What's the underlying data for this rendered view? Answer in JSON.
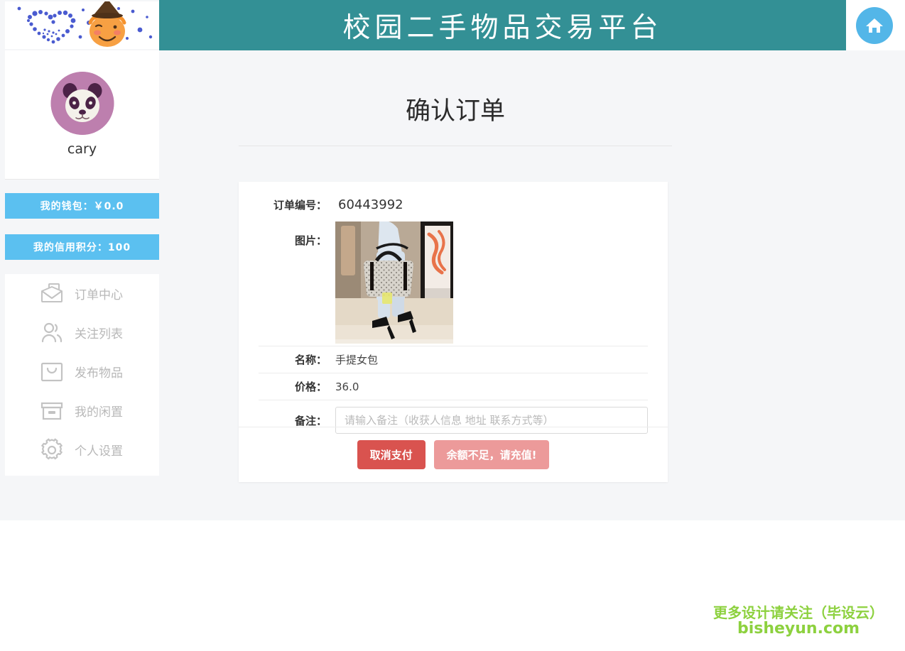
{
  "header": {
    "site_title": "校园二手物品交易平台",
    "home_icon": "home-icon",
    "bg_color": "#339095",
    "home_color": "#53b6e8"
  },
  "sidebar": {
    "banner_icons": [
      "dotted-heart-icon",
      "pumpkin-witch-icon"
    ],
    "avatar_icon": "panda-avatar",
    "username": "cary",
    "wallet": {
      "label": "我的钱包：￥0.0",
      "color": "#5bc0f0"
    },
    "credit": {
      "label": "我的信用积分：100",
      "color": "#5bc0f0"
    },
    "items": [
      {
        "label": "订单中心",
        "icon": "envelope-icon"
      },
      {
        "label": "关注列表",
        "icon": "users-icon"
      },
      {
        "label": "发布物品",
        "icon": "bag-icon"
      },
      {
        "label": "我的闲置",
        "icon": "box-icon"
      },
      {
        "label": "个人设置",
        "icon": "gear-icon"
      }
    ]
  },
  "main": {
    "page_title": "确认订单",
    "order": {
      "order_no_label": "订单编号：",
      "order_no_value": "60443992",
      "image_label": "图片：",
      "image_alt": "handbag-product-photo",
      "name_label": "名称：",
      "name_value": "手提女包",
      "price_label": "价格：",
      "price_value": "36.0",
      "note_label": "备注：",
      "note_value": "",
      "note_placeholder": "请输入备注（收获人信息 地址 联系方式等）"
    },
    "actions": {
      "cancel_label": "取消支付",
      "cancel_color": "#d9534f",
      "insufficient_label": "余额不足，请充值!",
      "insufficient_color": "#ec9a9a"
    }
  },
  "watermark": {
    "line1": "更多设计请关注（毕设云）",
    "line2": "bisheyun.com",
    "color": "#8dd13f"
  }
}
